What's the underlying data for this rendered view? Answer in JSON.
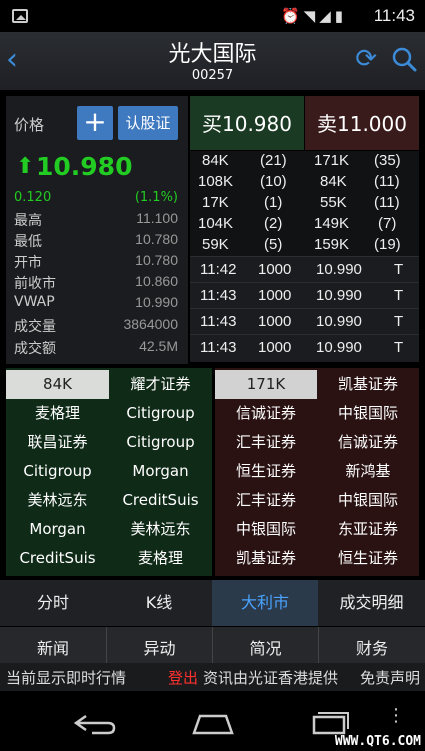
{
  "status_bar": {
    "time": "11:43",
    "icons": [
      "image-icon",
      "alarm-icon",
      "wifi-icon",
      "signal-icon",
      "battery-icon"
    ]
  },
  "header": {
    "title": "光大国际",
    "code": "00257"
  },
  "quote": {
    "price_label": "价格",
    "plus_label": "+",
    "warrant_label": "认股证",
    "price": "10.980",
    "change": "0.120",
    "change_pct": "(1.1%)",
    "stats": [
      {
        "label": "最高",
        "value": "11.100"
      },
      {
        "label": "最低",
        "value": "10.780"
      },
      {
        "label": "开市",
        "value": "10.780"
      },
      {
        "label": "前收市",
        "value": "10.860"
      },
      {
        "label": "VWAP",
        "value": "10.990"
      },
      {
        "label": "成交量",
        "value": "3864000"
      },
      {
        "label": "成交额",
        "value": "42.5M"
      }
    ]
  },
  "order_book": {
    "bid_label": "买10.980",
    "ask_label": "卖11.000",
    "rows": [
      {
        "bid_vol": "84K",
        "bid_cnt": "(21)",
        "ask_vol": "171K",
        "ask_cnt": "(35)"
      },
      {
        "bid_vol": "108K",
        "bid_cnt": "(10)",
        "ask_vol": "84K",
        "ask_cnt": "(11)"
      },
      {
        "bid_vol": "17K",
        "bid_cnt": "(1)",
        "ask_vol": "55K",
        "ask_cnt": "(11)"
      },
      {
        "bid_vol": "104K",
        "bid_cnt": "(2)",
        "ask_vol": "149K",
        "ask_cnt": "(7)"
      },
      {
        "bid_vol": "59K",
        "bid_cnt": "(5)",
        "ask_vol": "159K",
        "ask_cnt": "(19)"
      }
    ]
  },
  "trades": [
    {
      "time": "11:42",
      "vol": "1000",
      "price": "10.990",
      "flag": "T"
    },
    {
      "time": "11:43",
      "vol": "1000",
      "price": "10.990",
      "flag": "T"
    },
    {
      "time": "11:43",
      "vol": "1000",
      "price": "10.990",
      "flag": "T"
    },
    {
      "time": "11:43",
      "vol": "1000",
      "price": "10.990",
      "flag": "T"
    }
  ],
  "broker_bid": [
    [
      "84K",
      "耀才证券"
    ],
    [
      "麦格理",
      "Citigroup"
    ],
    [
      "联昌证券",
      "Citigroup"
    ],
    [
      "Citigroup",
      "Morgan"
    ],
    [
      "美林远东",
      "CreditSuis"
    ],
    [
      "Morgan",
      "美林远东"
    ],
    [
      "CreditSuis",
      "麦格理"
    ]
  ],
  "broker_ask": [
    [
      "171K",
      "凯基证券"
    ],
    [
      "信诚证券",
      "中银国际"
    ],
    [
      "汇丰证券",
      "信诚证券"
    ],
    [
      "恒生证券",
      "新鸿基"
    ],
    [
      "汇丰证券",
      "中银国际"
    ],
    [
      "中银国际",
      "东亚证券"
    ],
    [
      "凯基证券",
      "恒生证券"
    ]
  ],
  "tabs_primary": [
    "分时",
    "K线",
    "大利市",
    "成交明细"
  ],
  "tabs_secondary": [
    "新闻",
    "异动",
    "简况",
    "财务"
  ],
  "info_bar": {
    "left": "当前显示即时行情",
    "login": "登出",
    "source": "资讯由光证香港提供",
    "disclaimer": "免责声明"
  },
  "watermark": "WWW.QT6.COM",
  "colors": {
    "up": "#22cc22",
    "accent": "#3f79c0",
    "active_tab": "#4aa3ff",
    "logout": "#ff3030"
  }
}
